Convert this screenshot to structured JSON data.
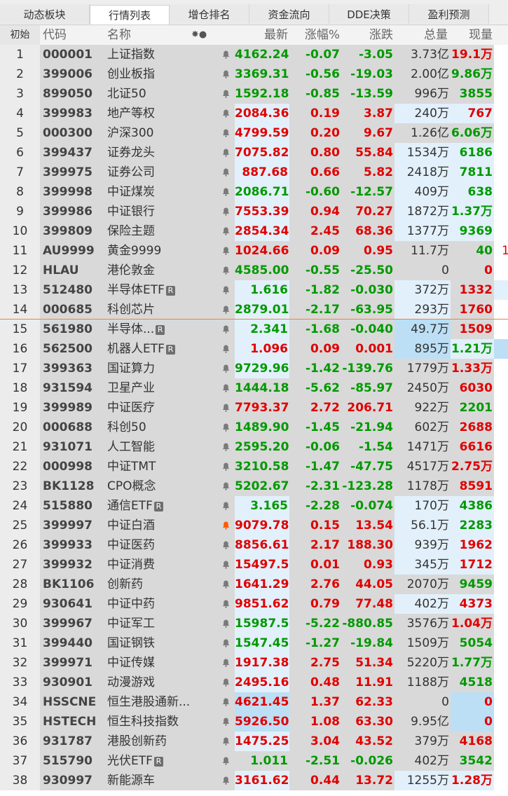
{
  "tabs": [
    "动态板块",
    "行情列表",
    "增仓排名",
    "资金流向",
    "DDE决策",
    "盈利预测"
  ],
  "active_tab": 1,
  "columns": {
    "index": "初始",
    "code": "代码",
    "name": "名称",
    "flag": "✸●",
    "price": "最新",
    "pct": "涨幅%",
    "change": "涨跌",
    "total_volume": "总量",
    "current_volume": "现量"
  },
  "colors": {
    "up": "#e00000",
    "down": "#009900",
    "selected_cell": "#e2f0fb",
    "highlight_cell": "#bcdff5",
    "bell_alert": "#ff5a00",
    "separator": "#f08040"
  },
  "rows": [
    {
      "idx": "1",
      "code": "000001",
      "name": "上证指数",
      "price": "4162.24",
      "pct": "-0.07",
      "change": "-3.05",
      "vol": "3.73亿",
      "cur": "19.1万",
      "dir": "dn",
      "cur_dir": "up",
      "extra": ""
    },
    {
      "idx": "2",
      "code": "399006",
      "name": "创业板指",
      "price": "3369.31",
      "pct": "-0.56",
      "change": "-19.03",
      "vol": "2.00亿",
      "cur": "9.86万",
      "dir": "dn",
      "cur_dir": "dn",
      "extra": ""
    },
    {
      "idx": "3",
      "code": "899050",
      "name": "北证50",
      "price": "1592.18",
      "pct": "-0.85",
      "change": "-13.59",
      "vol": "996万",
      "cur": "3855",
      "dir": "dn",
      "cur_dir": "dn",
      "extra": ""
    },
    {
      "idx": "4",
      "code": "399983",
      "name": "地产等权",
      "price": "2084.36",
      "pct": "0.19",
      "change": "3.87",
      "vol": "240万",
      "cur": "767",
      "dir": "up",
      "cur_dir": "up",
      "extra": "",
      "price_bg": "sel",
      "vol_bg": "sel",
      "cur_bg": "sel"
    },
    {
      "idx": "5",
      "code": "000300",
      "name": "沪深300",
      "price": "4799.59",
      "pct": "0.20",
      "change": "9.67",
      "vol": "1.26亿",
      "cur": "6.06万",
      "dir": "up",
      "cur_dir": "dn",
      "extra": "",
      "price_bg": "sel"
    },
    {
      "idx": "6",
      "code": "399437",
      "name": "证券龙头",
      "price": "7075.82",
      "pct": "0.80",
      "change": "55.84",
      "vol": "1534万",
      "cur": "6186",
      "dir": "up",
      "cur_dir": "dn",
      "extra": "",
      "price_bg": "sel",
      "vol_bg": "sel",
      "cur_bg": "sel"
    },
    {
      "idx": "7",
      "code": "399975",
      "name": "证券公司",
      "price": "887.68",
      "pct": "0.66",
      "change": "5.82",
      "vol": "2418万",
      "cur": "7811",
      "dir": "up",
      "cur_dir": "dn",
      "extra": "",
      "price_bg": "sel",
      "vol_bg": "sel",
      "cur_bg": "sel"
    },
    {
      "idx": "8",
      "code": "399998",
      "name": "中证煤炭",
      "price": "2086.71",
      "pct": "-0.60",
      "change": "-12.57",
      "vol": "409万",
      "cur": "638",
      "dir": "dn",
      "cur_dir": "dn",
      "extra": "",
      "price_bg": "sel",
      "vol_bg": "sel",
      "cur_bg": "sel"
    },
    {
      "idx": "9",
      "code": "399986",
      "name": "中证银行",
      "price": "7553.39",
      "pct": "0.94",
      "change": "70.27",
      "vol": "1872万",
      "cur": "1.37万",
      "dir": "up",
      "cur_dir": "dn",
      "extra": "",
      "price_bg": "sel",
      "vol_bg": "sel",
      "cur_bg": "sel"
    },
    {
      "idx": "10",
      "code": "399809",
      "name": "保险主题",
      "price": "2854.34",
      "pct": "2.45",
      "change": "68.36",
      "vol": "1377万",
      "cur": "9369",
      "dir": "up",
      "cur_dir": "dn",
      "extra": "",
      "price_bg": "sel",
      "vol_bg": "sel",
      "cur_bg": "sel"
    },
    {
      "idx": "11",
      "code": "AU9999",
      "name": "黄金9999",
      "price": "1024.66",
      "pct": "0.09",
      "change": "0.95",
      "vol": "11.7万",
      "cur": "40",
      "dir": "up",
      "cur_dir": "dn",
      "extra": "1"
    },
    {
      "idx": "12",
      "code": "HLAU",
      "name": "港伦敦金",
      "price": "4585.00",
      "pct": "-0.55",
      "change": "-25.50",
      "vol": "0",
      "cur": "0",
      "dir": "dn",
      "cur_dir": "up",
      "extra": ""
    },
    {
      "idx": "13",
      "code": "512480",
      "name": "半导体ETF",
      "rb": true,
      "price": "1.616",
      "pct": "-1.82",
      "change": "-0.030",
      "vol": "372万",
      "cur": "1332",
      "dir": "dn",
      "cur_dir": "up",
      "extra": "",
      "price_bg": "sel",
      "vol_bg": "sel",
      "extra_bg": "sel"
    },
    {
      "idx": "14",
      "code": "000685",
      "name": "科创芯片",
      "price": "2879.01",
      "pct": "-2.17",
      "change": "-63.95",
      "vol": "293万",
      "cur": "1760",
      "dir": "dn",
      "cur_dir": "up",
      "extra": "",
      "price_bg": "sel",
      "vol_bg": "sel"
    },
    {
      "idx": "15",
      "code": "561980",
      "name": "半导体...",
      "rb": true,
      "price": "2.341",
      "pct": "-1.68",
      "change": "-0.040",
      "vol": "49.7万",
      "cur": "1509",
      "dir": "dn",
      "cur_dir": "up",
      "extra": "",
      "price_bg": "sel",
      "vol_bg": "hl"
    },
    {
      "idx": "16",
      "code": "562500",
      "name": "机器人ETF",
      "rb": true,
      "price": "1.096",
      "pct": "0.09",
      "change": "0.001",
      "vol": "895万",
      "cur": "1.21万",
      "dir": "up",
      "cur_dir": "dn",
      "extra": "",
      "price_bg": "sel",
      "vol_bg": "hl",
      "cur_bg": "sel",
      "extra_bg": "hl"
    },
    {
      "idx": "17",
      "code": "399363",
      "name": "国证算力",
      "price": "9729.96",
      "pct": "-1.42",
      "change": "-139.76",
      "vol": "1779万",
      "cur": "1.33万",
      "dir": "dn",
      "cur_dir": "up",
      "extra": "",
      "price_bg": "sel"
    },
    {
      "idx": "18",
      "code": "931594",
      "name": "卫星产业",
      "price": "1444.18",
      "pct": "-5.62",
      "change": "-85.97",
      "vol": "2450万",
      "cur": "6030",
      "dir": "dn",
      "cur_dir": "up",
      "extra": ""
    },
    {
      "idx": "19",
      "code": "399989",
      "name": "中证医疗",
      "price": "7793.37",
      "pct": "2.72",
      "change": "206.71",
      "vol": "922万",
      "cur": "2201",
      "dir": "up",
      "cur_dir": "dn",
      "extra": ""
    },
    {
      "idx": "20",
      "code": "000688",
      "name": "科创50",
      "price": "1489.90",
      "pct": "-1.45",
      "change": "-21.94",
      "vol": "602万",
      "cur": "2688",
      "dir": "dn",
      "cur_dir": "up",
      "extra": ""
    },
    {
      "idx": "21",
      "code": "931071",
      "name": "人工智能",
      "price": "2595.20",
      "pct": "-0.06",
      "change": "-1.54",
      "vol": "1471万",
      "cur": "6616",
      "dir": "dn",
      "cur_dir": "up",
      "extra": ""
    },
    {
      "idx": "22",
      "code": "000998",
      "name": "中证TMT",
      "price": "3210.58",
      "pct": "-1.47",
      "change": "-47.75",
      "vol": "4517万",
      "cur": "2.75万",
      "dir": "dn",
      "cur_dir": "up",
      "extra": ""
    },
    {
      "idx": "23",
      "code": "BK1128",
      "name": "CPO概念",
      "price": "5202.67",
      "pct": "-2.31",
      "change": "-123.28",
      "vol": "1178万",
      "cur": "8591",
      "dir": "dn",
      "cur_dir": "up",
      "extra": ""
    },
    {
      "idx": "24",
      "code": "515880",
      "name": "通信ETF",
      "rb": true,
      "price": "3.165",
      "pct": "-2.28",
      "change": "-0.074",
      "vol": "170万",
      "cur": "4386",
      "dir": "dn",
      "cur_dir": "dn",
      "extra": "",
      "price_bg": "sel",
      "vol_bg": "sel",
      "cur_bg": "sel"
    },
    {
      "idx": "25",
      "code": "399997",
      "name": "中证白酒",
      "alert": true,
      "price": "9079.78",
      "pct": "0.15",
      "change": "13.54",
      "vol": "56.1万",
      "cur": "2283",
      "dir": "up",
      "cur_dir": "dn",
      "extra": "",
      "price_bg": "sel",
      "vol_bg": "sel",
      "cur_bg": "sel"
    },
    {
      "idx": "26",
      "code": "399933",
      "name": "中证医药",
      "price": "8856.61",
      "pct": "2.17",
      "change": "188.30",
      "vol": "939万",
      "cur": "1962",
      "dir": "up",
      "cur_dir": "up",
      "extra": "",
      "price_bg": "sel",
      "vol_bg": "sel",
      "cur_bg": "sel"
    },
    {
      "idx": "27",
      "code": "399932",
      "name": "中证消费",
      "price": "15497.51",
      "pct": "0.01",
      "change": "0.93",
      "vol": "345万",
      "cur": "1712",
      "dir": "up",
      "cur_dir": "up",
      "extra": "",
      "price_bg": "sel",
      "vol_bg": "sel",
      "cur_bg": "sel"
    },
    {
      "idx": "28",
      "code": "BK1106",
      "name": "创新药",
      "price": "1641.29",
      "pct": "2.76",
      "change": "44.05",
      "vol": "2070万",
      "cur": "9459",
      "dir": "up",
      "cur_dir": "dn",
      "extra": "",
      "price_bg": "sel"
    },
    {
      "idx": "29",
      "code": "930641",
      "name": "中证中药",
      "price": "9851.62",
      "pct": "0.79",
      "change": "77.48",
      "vol": "402万",
      "cur": "4373",
      "dir": "up",
      "cur_dir": "up",
      "extra": "",
      "price_bg": "sel",
      "vol_bg": "sel",
      "cur_bg": "sel"
    },
    {
      "idx": "30",
      "code": "399967",
      "name": "中证军工",
      "price": "15987.55",
      "pct": "-5.22",
      "change": "-880.85",
      "vol": "3576万",
      "cur": "1.04万",
      "dir": "dn",
      "cur_dir": "up",
      "extra": "",
      "price_bg": "sel"
    },
    {
      "idx": "31",
      "code": "399440",
      "name": "国证钢铁",
      "price": "1547.45",
      "pct": "-1.27",
      "change": "-19.84",
      "vol": "1509万",
      "cur": "5054",
      "dir": "dn",
      "cur_dir": "dn",
      "extra": "",
      "price_bg": "sel"
    },
    {
      "idx": "32",
      "code": "399971",
      "name": "中证传媒",
      "price": "1917.38",
      "pct": "2.75",
      "change": "51.34",
      "vol": "5220万",
      "cur": "1.77万",
      "dir": "up",
      "cur_dir": "dn",
      "extra": "",
      "price_bg": "sel"
    },
    {
      "idx": "33",
      "code": "930901",
      "name": "动漫游戏",
      "price": "2495.16",
      "pct": "0.48",
      "change": "11.91",
      "vol": "1188万",
      "cur": "4518",
      "dir": "up",
      "cur_dir": "dn",
      "extra": "",
      "price_bg": "sel"
    },
    {
      "idx": "34",
      "code": "HSSCNE",
      "name": "恒生港股通新...",
      "price": "4621.45",
      "pct": "1.37",
      "change": "62.33",
      "vol": "0",
      "cur": "0",
      "dir": "up",
      "cur_dir": "up",
      "extra": "",
      "price_bg": "hl",
      "cur_bg": "hl"
    },
    {
      "idx": "35",
      "code": "HSTECH",
      "name": "恒生科技指数",
      "price": "5926.50",
      "pct": "1.08",
      "change": "63.30",
      "vol": "9.95亿",
      "cur": "0",
      "dir": "up",
      "cur_dir": "up",
      "extra": "",
      "price_bg": "hl",
      "cur_bg": "hl"
    },
    {
      "idx": "36",
      "code": "931787",
      "name": "港股创新药",
      "price": "1475.25",
      "pct": "3.04",
      "change": "43.52",
      "vol": "379万",
      "cur": "4168",
      "dir": "up",
      "cur_dir": "up",
      "extra": "",
      "price_bg": "sel"
    },
    {
      "idx": "37",
      "code": "515790",
      "name": "光伏ETF",
      "rb": true,
      "price": "1.011",
      "pct": "-2.51",
      "change": "-0.026",
      "vol": "402万",
      "cur": "3542",
      "dir": "dn",
      "cur_dir": "dn",
      "extra": ""
    },
    {
      "idx": "38",
      "code": "930997",
      "name": "新能源车",
      "price": "3161.62",
      "pct": "0.44",
      "change": "13.72",
      "vol": "1255万",
      "cur": "1.28万",
      "dir": "up",
      "cur_dir": "up",
      "extra": "",
      "price_bg": "sel",
      "vol_bg": "sel",
      "cur_bg": "sel"
    }
  ]
}
